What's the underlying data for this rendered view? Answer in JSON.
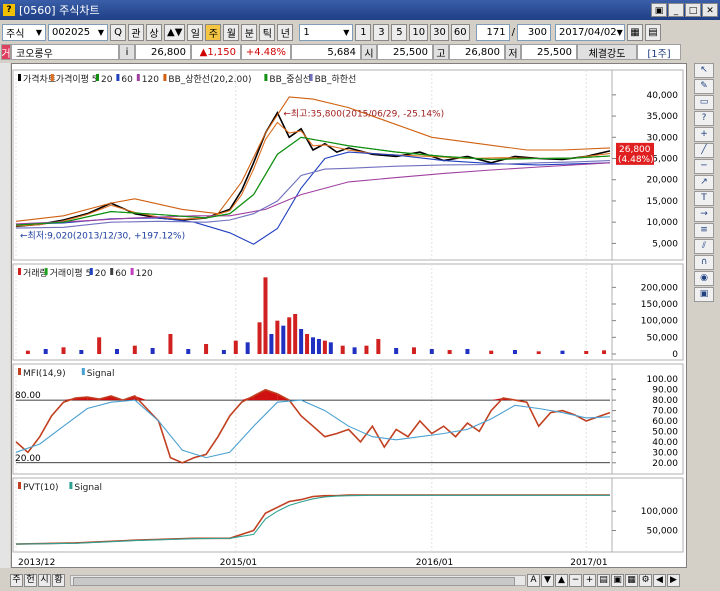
{
  "window": {
    "screen_id": "[0560]",
    "title": "주식차트",
    "qmark": "?"
  },
  "toolbar": {
    "market": "주식",
    "code": "002025",
    "btn_search": "Q",
    "btn_rel": "관",
    "btn_up": "상",
    "periods": [
      "일",
      "주",
      "월",
      "분",
      "틱",
      "년"
    ],
    "active_period_index": 1,
    "unit": "1",
    "units": [
      "1",
      "3",
      "5",
      "10",
      "30",
      "60"
    ],
    "count": "171",
    "total": "300",
    "date": "2017/04/02"
  },
  "quote": {
    "tag": "거",
    "name": "코오롱우",
    "price": "26,800",
    "change": "▲1,150",
    "change_pct": "+4.48%",
    "volume": "5,684",
    "open_label": "시",
    "open": "25,500",
    "high_label": "고",
    "high": "26,800",
    "low_label": "저",
    "low": "25,500",
    "strength_label": "체결강도",
    "period_tag": "[1주]"
  },
  "chart_data": [
    {
      "type": "line",
      "panel": "price",
      "legend": [
        "가격차트",
        "가격이평 5",
        "20",
        "60",
        "120",
        "BB_상한선(20,2.00)",
        "BB_중심선",
        "BB_하한선"
      ],
      "y_ticks": [
        40000,
        35000,
        30000,
        25000,
        20000,
        15000,
        10000,
        5000
      ],
      "ylim": [
        2500,
        43500
      ],
      "annotations": {
        "high": "최고:35,800(2015/06/29, -25.14%)",
        "low": "최저:9,020(2013/12/30, +197.12%)",
        "last_price": "26,800",
        "last_pct": "(4.48%)"
      },
      "series": [
        {
          "name": "가격차트",
          "color": "#000000",
          "x": [
            0,
            0.04,
            0.08,
            0.12,
            0.16,
            0.2,
            0.24,
            0.28,
            0.32,
            0.36,
            0.38,
            0.4,
            0.42,
            0.44,
            0.46,
            0.48,
            0.5,
            0.52,
            0.54,
            0.56,
            0.6,
            0.64,
            0.68,
            0.72,
            0.76,
            0.8,
            0.84,
            0.88,
            0.92,
            0.96,
            1.0
          ],
          "values": [
            9020,
            9500,
            10500,
            12000,
            14500,
            12000,
            11000,
            10500,
            11000,
            13000,
            17500,
            24000,
            31000,
            35800,
            30000,
            32000,
            27000,
            28500,
            26500,
            27500,
            26000,
            25500,
            26500,
            24500,
            25500,
            24000,
            25500,
            25000,
            24800,
            25500,
            26800
          ]
        },
        {
          "name": "가격이평 5",
          "color": "#e07020",
          "x": [
            0,
            0.04,
            0.08,
            0.12,
            0.16,
            0.2,
            0.24,
            0.28,
            0.32,
            0.36,
            0.38,
            0.4,
            0.42,
            0.44,
            0.46,
            0.48,
            0.5,
            0.52,
            0.56,
            0.6,
            0.64,
            0.7,
            0.76,
            0.82,
            0.88,
            0.94,
            1.0
          ],
          "values": [
            9100,
            9400,
            10300,
            11800,
            14000,
            12300,
            11200,
            10700,
            11000,
            12700,
            16500,
            22500,
            29500,
            33500,
            31000,
            31500,
            28000,
            28200,
            27000,
            26200,
            25800,
            25500,
            25000,
            25200,
            25000,
            25100,
            26200
          ]
        },
        {
          "name": "20",
          "color": "#109010",
          "x": [
            0,
            0.08,
            0.16,
            0.24,
            0.32,
            0.36,
            0.4,
            0.44,
            0.48,
            0.52,
            0.56,
            0.64,
            0.72,
            0.8,
            0.88,
            0.94,
            1.0
          ],
          "values": [
            9300,
            10000,
            12500,
            11800,
            11000,
            12000,
            16500,
            26000,
            30000,
            29000,
            28000,
            26500,
            25500,
            24800,
            25000,
            25100,
            25600
          ]
        },
        {
          "name": "60",
          "color": "#2040c0",
          "x": [
            0,
            0.08,
            0.16,
            0.24,
            0.3,
            0.36,
            0.4,
            0.44,
            0.48,
            0.52,
            0.56,
            0.64,
            0.72,
            0.8,
            0.88,
            1.0
          ],
          "values": [
            9500,
            9800,
            10800,
            11000,
            10000,
            7500,
            4800,
            8500,
            18000,
            25000,
            26500,
            25800,
            24500,
            23800,
            23500,
            24000
          ]
        },
        {
          "name": "120",
          "color": "#a040a0",
          "x": [
            0,
            0.1,
            0.2,
            0.3,
            0.36,
            0.42,
            0.48,
            0.56,
            0.64,
            0.72,
            0.8,
            0.88,
            1.0
          ],
          "values": [
            9600,
            10200,
            11000,
            11500,
            11500,
            13000,
            16500,
            19500,
            20500,
            21500,
            22300,
            23000,
            24000
          ]
        },
        {
          "name": "BB_상한선(20,2.00)",
          "color": "#d06010",
          "x": [
            0,
            0.08,
            0.16,
            0.2,
            0.28,
            0.34,
            0.38,
            0.42,
            0.46,
            0.5,
            0.56,
            0.62,
            0.7,
            0.78,
            0.86,
            0.92,
            1.0
          ],
          "values": [
            10200,
            11500,
            14500,
            15500,
            13000,
            12000,
            19500,
            31000,
            39500,
            39000,
            37000,
            34000,
            30000,
            28500,
            27000,
            27000,
            27500
          ]
        },
        {
          "name": "BB_중심선",
          "color": "#109010",
          "x": [
            0,
            0.08,
            0.16,
            0.24,
            0.32,
            0.36,
            0.4,
            0.44,
            0.48,
            0.52,
            0.56,
            0.64,
            0.72,
            0.8,
            0.88,
            0.94,
            1.0
          ],
          "values": [
            9300,
            10000,
            12500,
            11800,
            11000,
            12000,
            16500,
            26000,
            30000,
            29000,
            28000,
            26500,
            25500,
            24800,
            25000,
            25100,
            25600
          ]
        },
        {
          "name": "BB_하한선",
          "color": "#7070c0",
          "x": [
            0,
            0.08,
            0.16,
            0.24,
            0.32,
            0.36,
            0.4,
            0.44,
            0.48,
            0.52,
            0.56,
            0.64,
            0.72,
            0.8,
            0.88,
            0.94,
            1.0
          ],
          "values": [
            8600,
            8800,
            10000,
            10200,
            10000,
            10500,
            12000,
            15000,
            21000,
            22500,
            22700,
            23200,
            23500,
            23600,
            24000,
            24200,
            24500
          ]
        }
      ]
    },
    {
      "type": "bar",
      "panel": "volume",
      "legend": [
        "거래량",
        "거래이평 5",
        "20",
        "60",
        "120"
      ],
      "y_ticks": [
        200000,
        150000,
        100000,
        50000,
        0
      ],
      "ylim": [
        0,
        240000
      ],
      "x": [
        0.02,
        0.05,
        0.08,
        0.11,
        0.14,
        0.17,
        0.2,
        0.23,
        0.26,
        0.29,
        0.32,
        0.35,
        0.37,
        0.39,
        0.41,
        0.42,
        0.43,
        0.44,
        0.45,
        0.46,
        0.47,
        0.48,
        0.49,
        0.5,
        0.51,
        0.52,
        0.53,
        0.55,
        0.57,
        0.59,
        0.61,
        0.64,
        0.67,
        0.7,
        0.73,
        0.76,
        0.8,
        0.84,
        0.88,
        0.92,
        0.96,
        0.99
      ],
      "values": [
        10000,
        15000,
        20000,
        12000,
        50000,
        15000,
        25000,
        18000,
        60000,
        15000,
        30000,
        12000,
        40000,
        35000,
        95000,
        230000,
        60000,
        100000,
        85000,
        110000,
        120000,
        75000,
        60000,
        50000,
        45000,
        40000,
        35000,
        25000,
        20000,
        25000,
        45000,
        18000,
        20000,
        15000,
        12000,
        15000,
        10000,
        12000,
        8000,
        10000,
        9000,
        11000
      ],
      "colors": [
        "r",
        "b",
        "r",
        "b",
        "r",
        "b",
        "r",
        "b",
        "r",
        "b",
        "r",
        "b",
        "r",
        "b",
        "r",
        "r",
        "b",
        "r",
        "b",
        "r",
        "r",
        "b",
        "r",
        "b",
        "b",
        "r",
        "b",
        "r",
        "b",
        "r",
        "r",
        "b",
        "r",
        "b",
        "r",
        "b",
        "r",
        "b",
        "r",
        "b",
        "r",
        "r"
      ]
    },
    {
      "type": "line",
      "panel": "mfi",
      "legend": [
        "MFI(14,9)",
        "Signal"
      ],
      "y_ticks": [
        100,
        90,
        80,
        70,
        60,
        50,
        40,
        30,
        20
      ],
      "ylim": [
        15,
        105
      ],
      "levels": {
        "upper": "80.00",
        "lower": "20.00"
      },
      "series": [
        {
          "name": "MFI(14,9)",
          "color": "#c04020",
          "x": [
            0,
            0.02,
            0.04,
            0.06,
            0.08,
            0.1,
            0.12,
            0.14,
            0.16,
            0.18,
            0.2,
            0.22,
            0.24,
            0.26,
            0.28,
            0.3,
            0.32,
            0.34,
            0.36,
            0.38,
            0.4,
            0.42,
            0.44,
            0.46,
            0.48,
            0.5,
            0.52,
            0.54,
            0.56,
            0.58,
            0.6,
            0.62,
            0.64,
            0.66,
            0.68,
            0.7,
            0.72,
            0.74,
            0.76,
            0.78,
            0.8,
            0.82,
            0.84,
            0.86,
            0.88,
            0.9,
            0.92,
            0.94,
            0.96,
            0.98,
            1.0
          ],
          "values": [
            40,
            30,
            45,
            65,
            78,
            82,
            83,
            81,
            84,
            80,
            84,
            72,
            60,
            25,
            20,
            25,
            28,
            45,
            65,
            78,
            84,
            90,
            86,
            80,
            65,
            55,
            45,
            48,
            52,
            40,
            55,
            35,
            52,
            45,
            60,
            48,
            55,
            45,
            58,
            50,
            70,
            82,
            80,
            78,
            55,
            68,
            70,
            66,
            60,
            64,
            68
          ]
        },
        {
          "name": "Signal",
          "color": "#4aa0d0",
          "x": [
            0,
            0.04,
            0.08,
            0.12,
            0.16,
            0.2,
            0.24,
            0.28,
            0.32,
            0.36,
            0.4,
            0.44,
            0.48,
            0.52,
            0.56,
            0.6,
            0.64,
            0.68,
            0.72,
            0.76,
            0.8,
            0.84,
            0.88,
            0.92,
            0.96,
            1.0
          ],
          "values": [
            30,
            38,
            55,
            72,
            78,
            80,
            60,
            32,
            25,
            30,
            55,
            78,
            80,
            70,
            55,
            45,
            42,
            45,
            48,
            52,
            62,
            75,
            72,
            68,
            63,
            64
          ]
        }
      ]
    },
    {
      "type": "line",
      "panel": "pvt",
      "legend": [
        "PVT(10)",
        "Signal"
      ],
      "y_ticks": [
        100000,
        50000
      ],
      "ylim": [
        10000,
        160000
      ],
      "series": [
        {
          "name": "PVT(10)",
          "color": "#c04020",
          "x": [
            0,
            0.1,
            0.2,
            0.3,
            0.36,
            0.4,
            0.42,
            0.44,
            0.46,
            0.48,
            0.5,
            0.52,
            0.54,
            0.56,
            0.6,
            0.7,
            0.8,
            0.9,
            1.0
          ],
          "values": [
            15000,
            18000,
            25000,
            30000,
            30000,
            50000,
            95000,
            110000,
            125000,
            130000,
            138000,
            140000,
            140000,
            142000,
            142000,
            142000,
            142000,
            142000,
            142000
          ]
        },
        {
          "name": "Signal",
          "color": "#30a090",
          "x": [
            0,
            0.1,
            0.2,
            0.3,
            0.36,
            0.4,
            0.42,
            0.44,
            0.46,
            0.48,
            0.5,
            0.52,
            0.54,
            0.56,
            0.6,
            0.7,
            0.8,
            0.9,
            1.0
          ],
          "values": [
            15000,
            17000,
            24000,
            29000,
            30000,
            40000,
            80000,
            100000,
            115000,
            124000,
            132000,
            137000,
            139000,
            140000,
            141000,
            141000,
            141000,
            141000,
            141000
          ]
        }
      ]
    }
  ],
  "x_axis": {
    "ticks": [
      "2013/12",
      "2015/01",
      "2016/01",
      "2017/01"
    ],
    "tick_positions": [
      0.0,
      0.37,
      0.7,
      0.96
    ]
  },
  "bottom": {
    "buttons": [
      "주",
      "헌",
      "시",
      "황"
    ],
    "nav": [
      "A",
      "▼",
      "▲"
    ]
  },
  "sidebar_icons": [
    "cursor-icon",
    "pencil-icon",
    "eraser-icon",
    "question-icon",
    "cross-icon",
    "line-icon",
    "hline-icon",
    "trend-icon",
    "text-icon",
    "arrow-icon",
    "fib-icon",
    "channel-icon",
    "magnet-icon",
    "eye-icon",
    "lock-icon"
  ]
}
